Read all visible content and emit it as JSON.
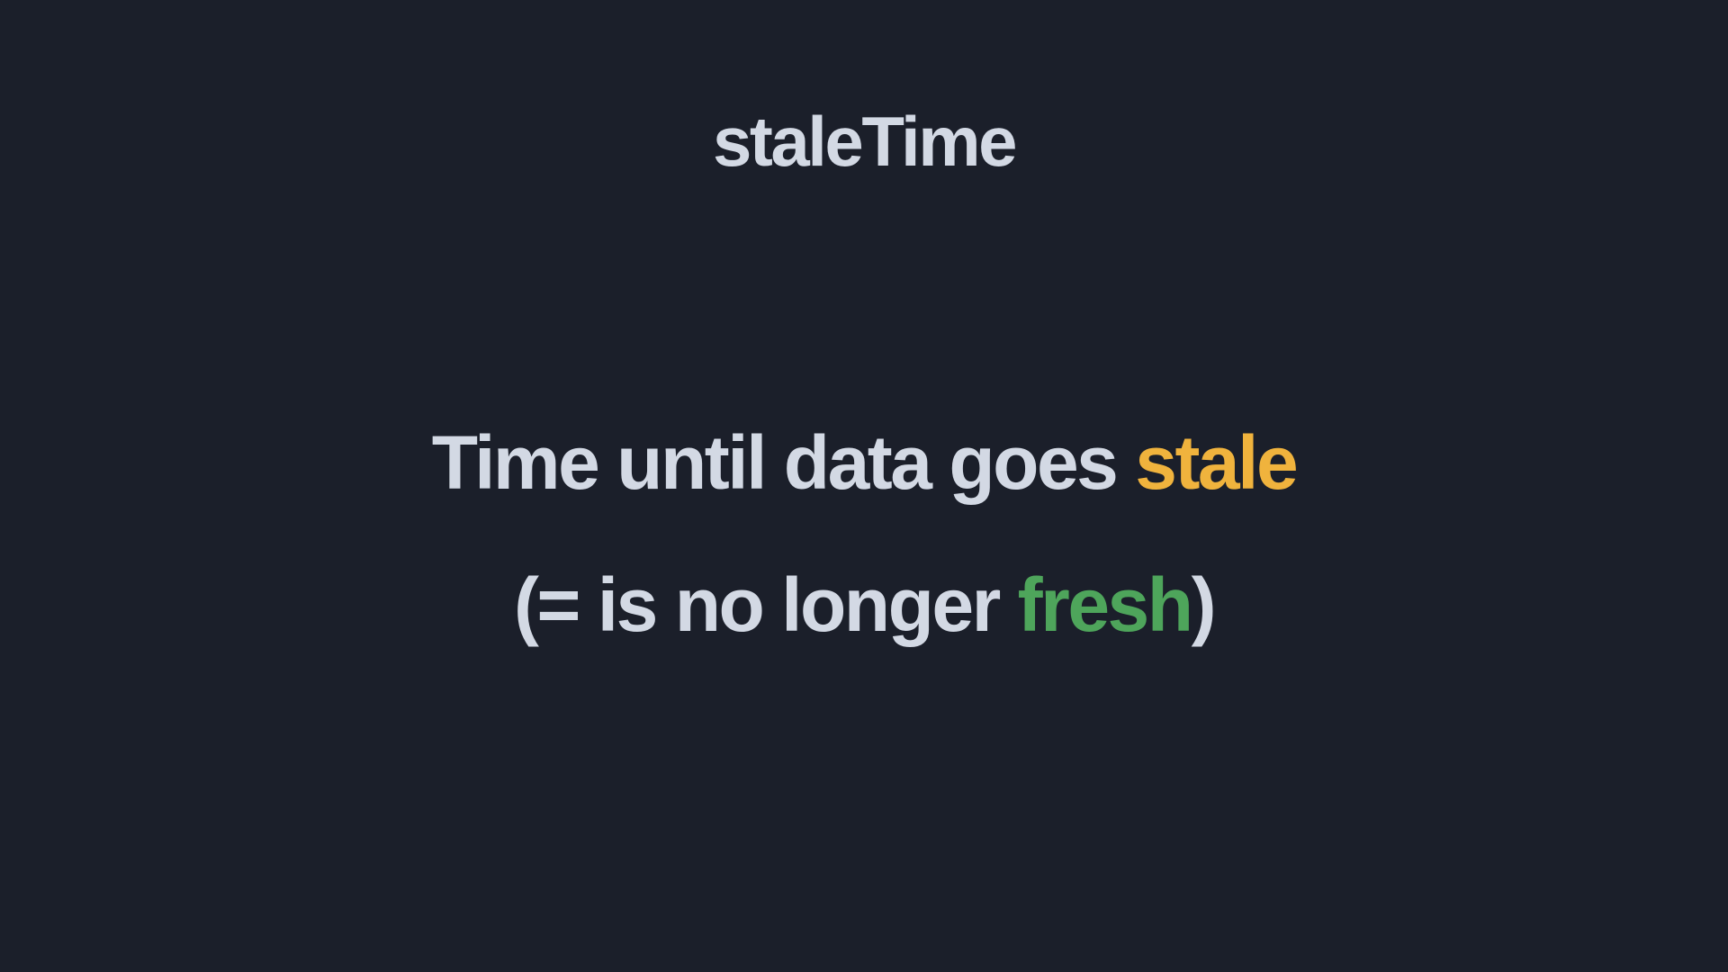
{
  "slide": {
    "title": "staleTime",
    "line1": {
      "prefix": "Time until data goes ",
      "highlight": "stale"
    },
    "line2": {
      "prefix": "(= is no longer ",
      "highlight": "fresh",
      "suffix": ")"
    }
  },
  "colors": {
    "background": "#1b1f2a",
    "text": "#d3d9e4",
    "stale": "#f0b33d",
    "fresh": "#4ea55b"
  }
}
